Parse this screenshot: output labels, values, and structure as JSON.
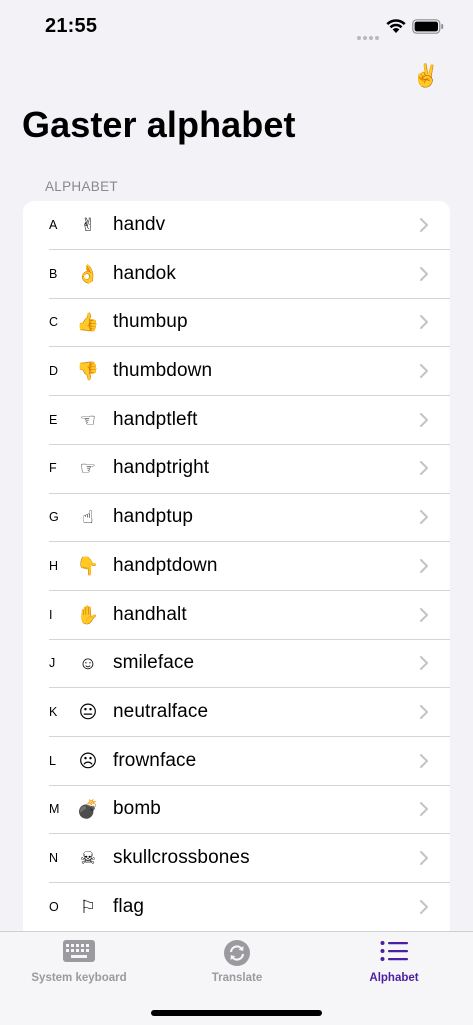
{
  "status_bar": {
    "time": "21:55"
  },
  "header": {
    "top_icon": "✌️",
    "title": "Gaster alphabet"
  },
  "section": {
    "header": "ALPHABET"
  },
  "rows": [
    {
      "letter": "A",
      "icon": "✌",
      "name": "handv"
    },
    {
      "letter": "B",
      "icon": "👌",
      "name": "handok"
    },
    {
      "letter": "C",
      "icon": "👍",
      "name": "thumbup"
    },
    {
      "letter": "D",
      "icon": "👎",
      "name": "thumbdown"
    },
    {
      "letter": "E",
      "icon": "☜",
      "name": "handptleft"
    },
    {
      "letter": "F",
      "icon": "☞",
      "name": "handptright"
    },
    {
      "letter": "G",
      "icon": "☝",
      "name": "handptup"
    },
    {
      "letter": "H",
      "icon": "👇",
      "name": "handptdown"
    },
    {
      "letter": "I",
      "icon": "✋",
      "name": "handhalt"
    },
    {
      "letter": "J",
      "icon": "☺",
      "name": "smileface"
    },
    {
      "letter": "K",
      "icon": "😐",
      "name": "neutralface"
    },
    {
      "letter": "L",
      "icon": "☹",
      "name": "frownface"
    },
    {
      "letter": "M",
      "icon": "💣",
      "name": "bomb"
    },
    {
      "letter": "N",
      "icon": "☠",
      "name": "skullcrossbones"
    },
    {
      "letter": "O",
      "icon": "⚐",
      "name": "flag"
    }
  ],
  "tab_bar": {
    "tabs": [
      {
        "label": "System keyboard",
        "icon": "keyboard-icon"
      },
      {
        "label": "Translate",
        "icon": "translate-icon"
      },
      {
        "label": "Alphabet",
        "icon": "list-icon"
      }
    ],
    "active": "Alphabet",
    "accent_color": "#4b1fa3"
  }
}
